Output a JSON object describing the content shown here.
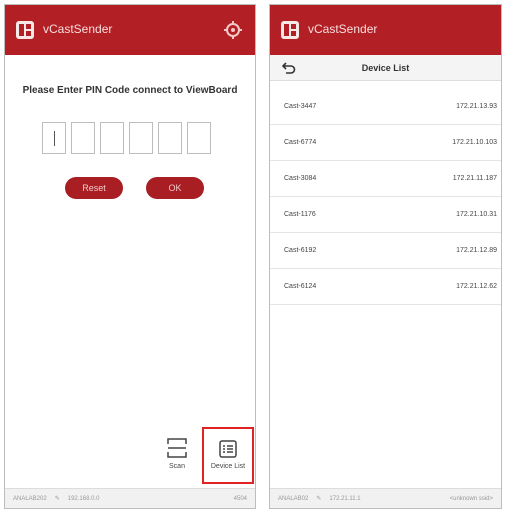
{
  "app": {
    "title": "vCastSender",
    "accent": "#b21f24"
  },
  "pin_screen": {
    "prompt": "Please Enter PIN Code connect to ViewBoard",
    "reset_label": "Reset",
    "ok_label": "OK",
    "scan_label": "Scan",
    "device_list_label": "Device List"
  },
  "left_status": {
    "left": "ANALAB202",
    "mid": "192.168.0.0",
    "right": "4504"
  },
  "list_screen": {
    "title": "Device List",
    "devices": [
      {
        "name": "Cast-3447",
        "ip": "172.21.13.93"
      },
      {
        "name": "Cast-6774",
        "ip": "172.21.10.103"
      },
      {
        "name": "Cast-3084",
        "ip": "172.21.11.187"
      },
      {
        "name": "Cast-1176",
        "ip": "172.21.10.31"
      },
      {
        "name": "Cast-6192",
        "ip": "172.21.12.89"
      },
      {
        "name": "Cast-6124",
        "ip": "172.21.12.62"
      }
    ]
  },
  "right_status": {
    "left": "ANALAB02",
    "mid": "172.21.11.1",
    "right": "<unknown ssid>"
  }
}
